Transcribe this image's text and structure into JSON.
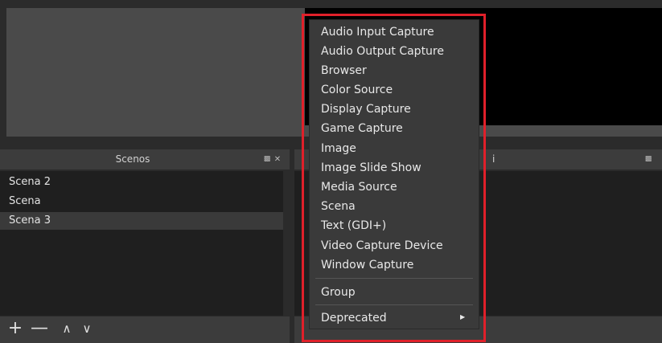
{
  "scenes_dock": {
    "title": "Scenos",
    "float_icon": "float-icon",
    "close_icon": "close-icon",
    "items": [
      "Scena 2",
      "Scena",
      "Scena 3"
    ],
    "selected": "Scena 3"
  },
  "sources_dock": {
    "title_fragment": "i"
  },
  "toolbar": {
    "add_glyph": "+",
    "remove_glyph": "—",
    "up_glyph": "∧",
    "down_glyph": "∨"
  },
  "context_menu": {
    "items": [
      "Audio Input Capture",
      "Audio Output Capture",
      "Browser",
      "Color Source",
      "Display Capture",
      "Game Capture",
      "Image",
      "Image Slide Show",
      "Media Source",
      "Scena",
      "Text (GDI+)",
      "Video Capture Device",
      "Window Capture"
    ],
    "group_label": "Group",
    "deprecated_label": "Deprecated"
  },
  "colors": {
    "highlight": "#e0202a",
    "menu_bg": "#3a3a3a",
    "list_bg": "#1f1f1f"
  }
}
